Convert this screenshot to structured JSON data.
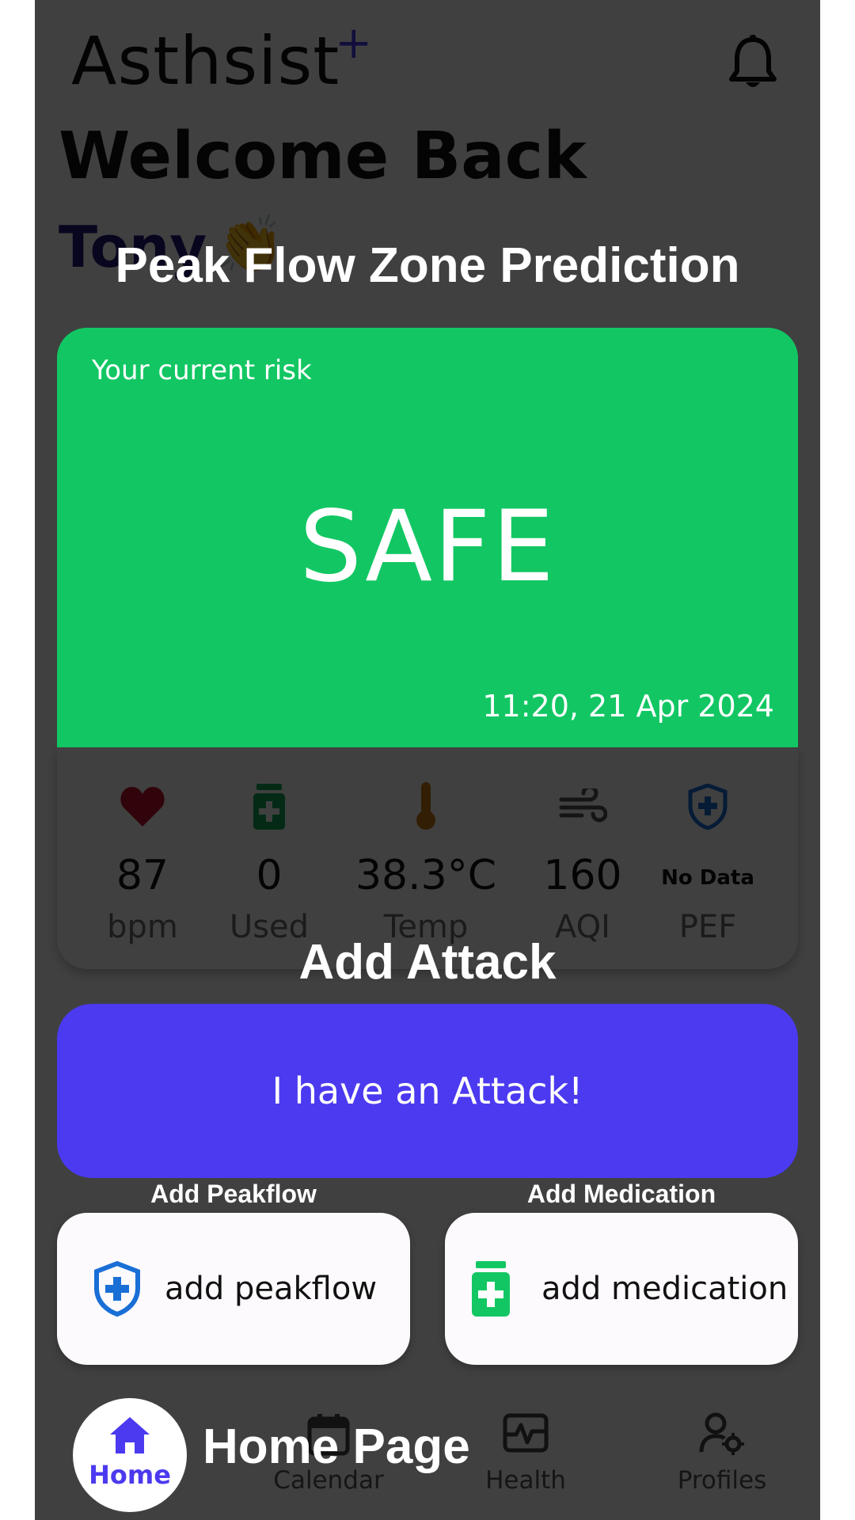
{
  "header": {
    "app_name": "Asthsist",
    "app_plus": "+",
    "welcome": "Welcome Back",
    "user_name": "Tony",
    "wave_emoji": "👏"
  },
  "risk": {
    "label": "Your current risk",
    "value": "SAFE",
    "timestamp": "11:20, 21 Apr 2024",
    "color": "#12c763"
  },
  "stats": [
    {
      "value": "87",
      "unit": "bpm",
      "icon": "heart-icon"
    },
    {
      "value": "0",
      "unit": "Used",
      "icon": "medication-icon"
    },
    {
      "value": "38.3°C",
      "unit": "Temp",
      "icon": "thermometer-icon"
    },
    {
      "value": "160",
      "unit": "AQI",
      "icon": "wind-icon"
    },
    {
      "value": "No Data",
      "unit": "PEF",
      "icon": "shield-plus-icon"
    }
  ],
  "actions": {
    "attack_label": "I have an Attack!",
    "peakflow_label": "add peakflow",
    "medication_label": "add medication",
    "accent": "#4b3af0"
  },
  "nav": [
    {
      "label": "Home",
      "icon": "home-icon"
    },
    {
      "label": "Calendar",
      "icon": "calendar-icon"
    },
    {
      "label": "Health",
      "icon": "pulse-icon"
    },
    {
      "label": "Profiles",
      "icon": "user-gear-icon"
    }
  ],
  "tutorial": {
    "peak_flow_zone": "Peak Flow Zone Prediction",
    "add_attack": "Add Attack",
    "add_peakflow": "Add Peakflow",
    "add_medication": "Add Medication",
    "home_page": "Home Page"
  }
}
